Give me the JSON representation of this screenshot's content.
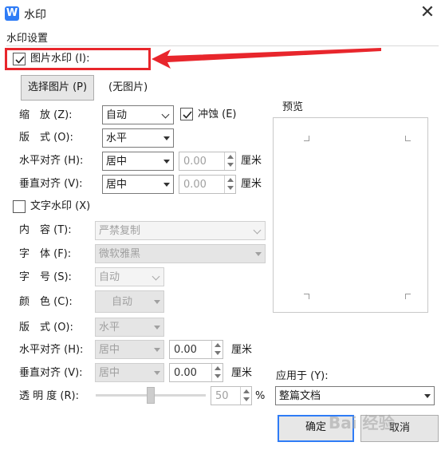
{
  "window": {
    "title": "水印",
    "close_glyph": "✕",
    "app_icon_letter": "W"
  },
  "group_title": "水印设置",
  "picture": {
    "checkbox_label": "图片水印 (I):",
    "checked": true,
    "choose_button": "选择图片 (P)",
    "no_image": "(无图片)",
    "zoom_label": "缩　放 (Z):",
    "zoom_value": "自动",
    "washout_label": "冲蚀 (E)",
    "washout_checked": true,
    "layout_label": "版　式 (O):",
    "layout_value": "水平",
    "halign_label": "水平对齐 (H):",
    "halign_value": "居中",
    "halign_offset": "0.00",
    "valign_label": "垂直对齐 (V):",
    "valign_value": "居中",
    "valign_offset": "0.00",
    "unit": "厘米"
  },
  "text": {
    "checkbox_label": "文字水印 (X)",
    "checked": false,
    "content_label": "内　容 (T):",
    "content_value": "严禁复制",
    "font_label": "字　体 (F):",
    "font_value": "微软雅黑",
    "size_label": "字　号 (S):",
    "size_value": "自动",
    "color_label": "颜　色 (C):",
    "color_value": "自动",
    "layout_label": "版　式 (O):",
    "layout_value": "水平",
    "halign_label": "水平对齐 (H):",
    "halign_value": "居中",
    "halign_offset": "0.00",
    "valign_label": "垂直对齐 (V):",
    "valign_value": "居中",
    "valign_offset": "0.00",
    "unit": "厘米",
    "transparency_label": "透 明 度 (R):",
    "transparency_value": "50",
    "percent": "%"
  },
  "preview": {
    "label": "预览"
  },
  "apply": {
    "label": "应用于 (Y):",
    "value": "整篇文档"
  },
  "buttons": {
    "ok": "确定",
    "cancel": "取消"
  },
  "watermark": "Bai 经验",
  "colors": {
    "accent": "#2f7cf6",
    "annotation": "#e8262c"
  }
}
